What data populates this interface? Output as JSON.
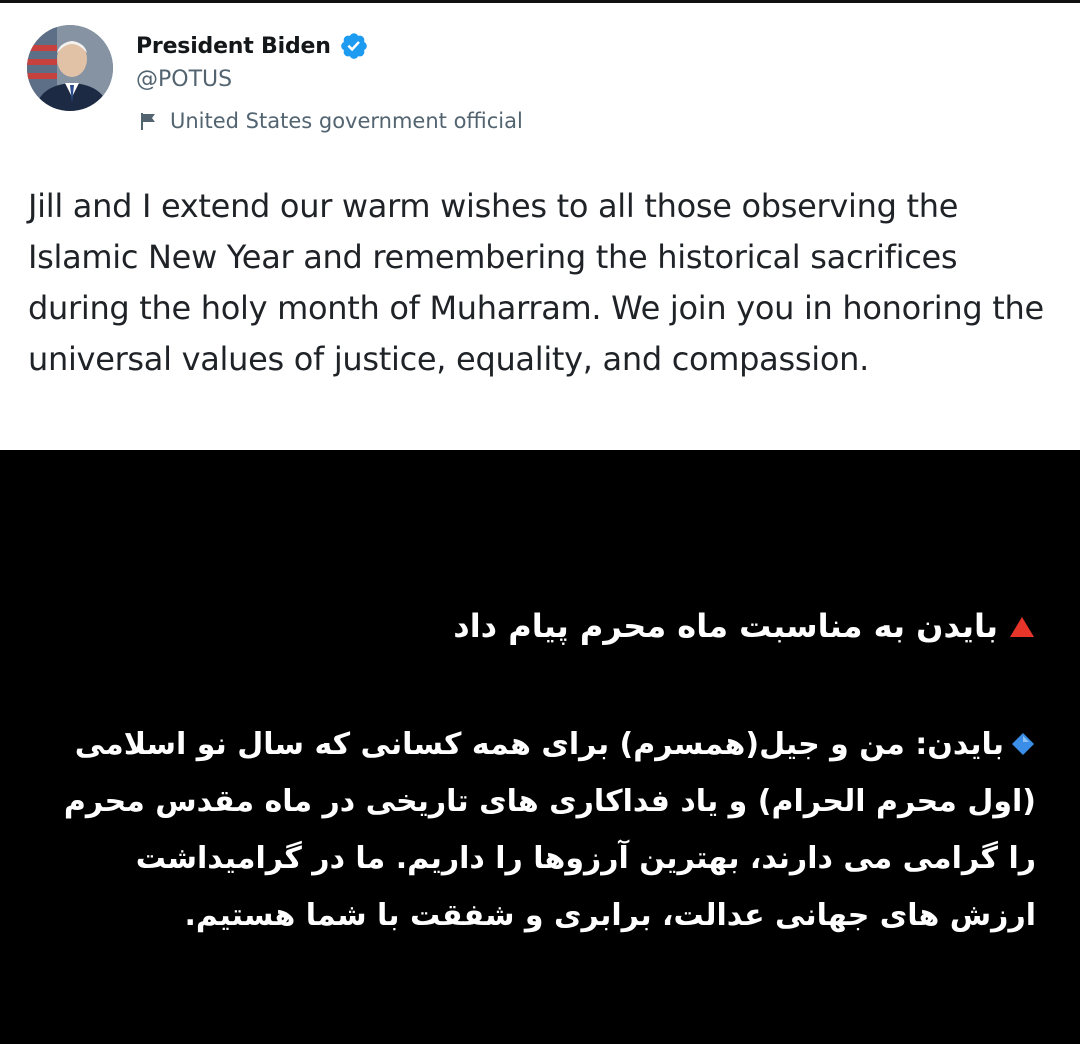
{
  "tweet": {
    "author": {
      "display_name": "President Biden",
      "handle": "@POTUS",
      "verified_icon": "verified-badge-icon",
      "label_icon": "flag-icon",
      "label": "United States government official"
    },
    "text": "Jill and I extend our warm wishes to all those observing the Islamic New Year and remembering the historical sacrifices during the holy month of Muharram. We join you in honoring the universal values of justice, equality, and compassion."
  },
  "caption": {
    "headline": "بایدن به مناسبت ماه محرم پیام داد",
    "headline_icon": "red-triangle-icon",
    "body": "بایدن: من و جیل(همسرم) برای همه کسانی که سال نو اسلامی (اول محرم الحرام) و یاد فداکاری های تاریخی در ماه مقدس محرم را گرامی می دارند، بهترین آرزوها را داریم. ما در گرامیداشت ارزش های جهانی عدالت، برابری و شفقت با شما هستیم.",
    "body_icon": "blue-diamond-icon"
  },
  "colors": {
    "background": "#000000",
    "card": "#ffffff",
    "verified": "#1d9bf0",
    "triangle": "#e8352a",
    "diamond": "#3b8ee8"
  }
}
